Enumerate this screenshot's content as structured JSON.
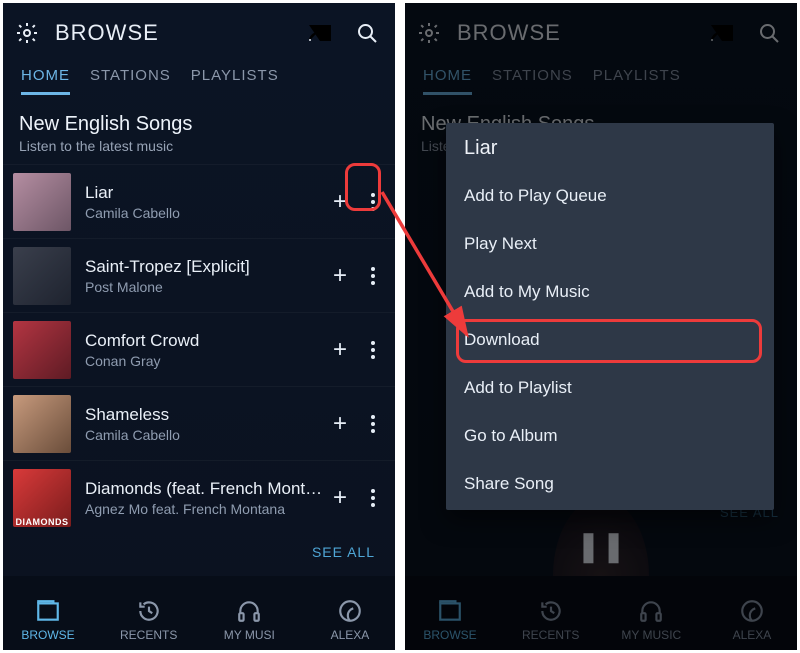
{
  "header": {
    "title": "BROWSE"
  },
  "tabs": [
    "HOME",
    "STATIONS",
    "PLAYLISTS"
  ],
  "section": {
    "title": "New English Songs",
    "subtitle": "Listen to the latest music"
  },
  "songs": [
    {
      "title": "Liar",
      "artist": "Camila Cabello",
      "cover_label": ""
    },
    {
      "title": "Saint-Tropez [Explicit]",
      "artist": "Post Malone",
      "cover_label": ""
    },
    {
      "title": "Comfort Crowd",
      "artist": "Conan Gray",
      "cover_label": ""
    },
    {
      "title": "Shameless",
      "artist": "Camila Cabello",
      "cover_label": ""
    },
    {
      "title": "Diamonds (feat. French Mont…",
      "artist": "Agnez Mo feat. French Montana",
      "cover_label": "DIAMONDS"
    }
  ],
  "see_all": "SEE ALL",
  "nav": {
    "items": [
      {
        "label": "BROWSE",
        "icon": "browse"
      },
      {
        "label": "RECENTS",
        "icon": "recents"
      },
      {
        "label": "MY MUSIC",
        "icon": "mymusic"
      },
      {
        "label": "ALEXA",
        "icon": "alexa"
      }
    ],
    "browse_label_trunc": "BROWSE",
    "recents_label_trunc": "RECENTS",
    "mymusic_label_trunc": "MY MUSI",
    "alexa_label_trunc": "ALEXA"
  },
  "menu": {
    "title": "Liar",
    "items": [
      "Add to Play Queue",
      "Play Next",
      "Add to My Music",
      "Download",
      "Add to Playlist",
      "Go to Album",
      "Share Song"
    ]
  },
  "pause_glyph": "❚❚"
}
